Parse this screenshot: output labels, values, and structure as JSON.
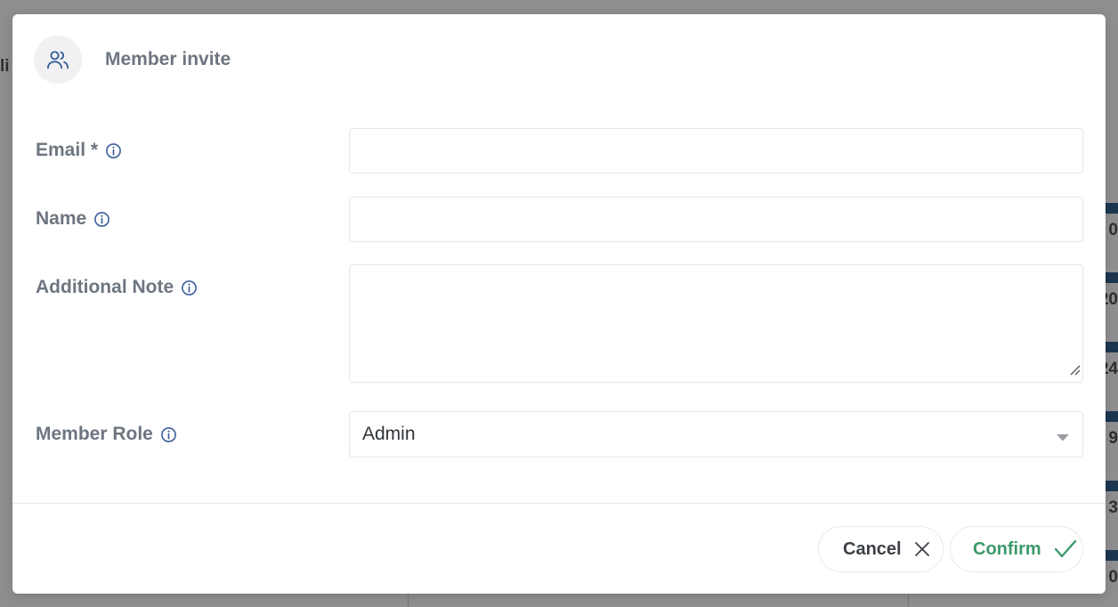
{
  "background": {
    "fragments": [
      "li",
      "0",
      "20",
      "24",
      "9",
      "3",
      "0"
    ]
  },
  "modal": {
    "title": "Member invite",
    "header_icon": "users-icon",
    "fields": {
      "email": {
        "label": "Email *",
        "value": "",
        "info_icon": "info-icon"
      },
      "name": {
        "label": "Name",
        "value": "",
        "info_icon": "info-icon"
      },
      "note": {
        "label": "Additional Note",
        "value": "",
        "info_icon": "info-icon"
      },
      "role": {
        "label": "Member Role",
        "value": "Admin",
        "info_icon": "info-icon"
      }
    },
    "buttons": {
      "cancel": {
        "label": "Cancel",
        "icon": "close-icon"
      },
      "confirm": {
        "label": "Confirm",
        "icon": "check-icon"
      }
    }
  },
  "colors": {
    "label": "#6d7580",
    "confirm": "#3d9a6b",
    "header_icon": "#3b5f9a",
    "overlay": "#8e8e90"
  }
}
